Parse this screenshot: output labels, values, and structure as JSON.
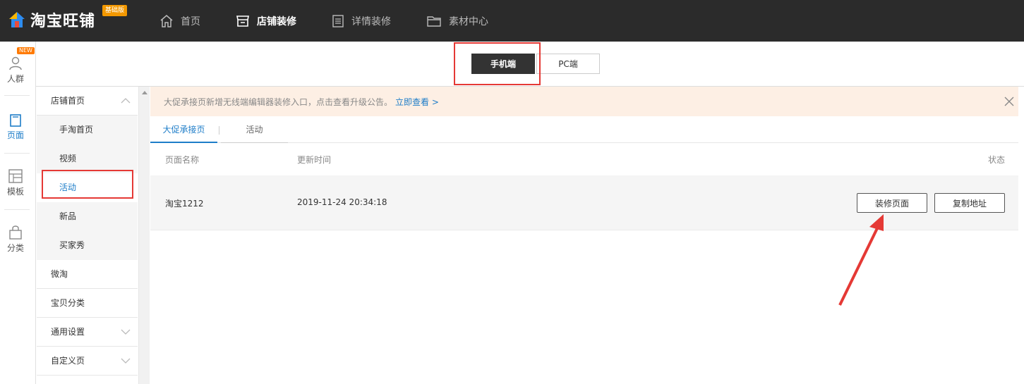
{
  "app": {
    "logo_text": "淘宝旺铺",
    "edition_badge": "基础版"
  },
  "topnav": [
    {
      "label": "首页",
      "icon": "home-icon"
    },
    {
      "label": "店铺装修",
      "icon": "shop-icon"
    },
    {
      "label": "详情装修",
      "icon": "document-icon"
    },
    {
      "label": "素材中心",
      "icon": "folder-icon"
    }
  ],
  "rail": [
    {
      "label": "人群",
      "icon": "person-icon",
      "badge": "NEW"
    },
    {
      "label": "页面",
      "icon": "page-icon"
    },
    {
      "label": "模板",
      "icon": "template-icon"
    },
    {
      "label": "分类",
      "icon": "bag-icon"
    }
  ],
  "device_switch": {
    "mobile": "手机端",
    "pc": "PC端"
  },
  "menu": {
    "group1": "店铺首页",
    "sub": [
      "手淘首页",
      "视频",
      "活动",
      "新品",
      "买家秀"
    ],
    "group2": "微淘",
    "group3": "宝贝分类",
    "group4": "通用设置",
    "group5": "自定义页"
  },
  "notice": {
    "text": "大促承接页新增无线端编辑器装修入口，点击查看升级公告。",
    "link": "立即查看 >"
  },
  "tabs": [
    "大促承接页",
    "活动"
  ],
  "table": {
    "headers": {
      "name": "页面名称",
      "time": "更新时间",
      "status": "状态"
    },
    "rows": [
      {
        "name": "淘宝1212",
        "time": "2019-11-24 20:34:18",
        "btn_decorate": "装修页面",
        "btn_copy": "复制地址"
      }
    ]
  },
  "colors": {
    "accent": "#1e7dc8",
    "topbar": "#2b2b2b",
    "highlight": "#e53935",
    "badge": "#f39800"
  }
}
